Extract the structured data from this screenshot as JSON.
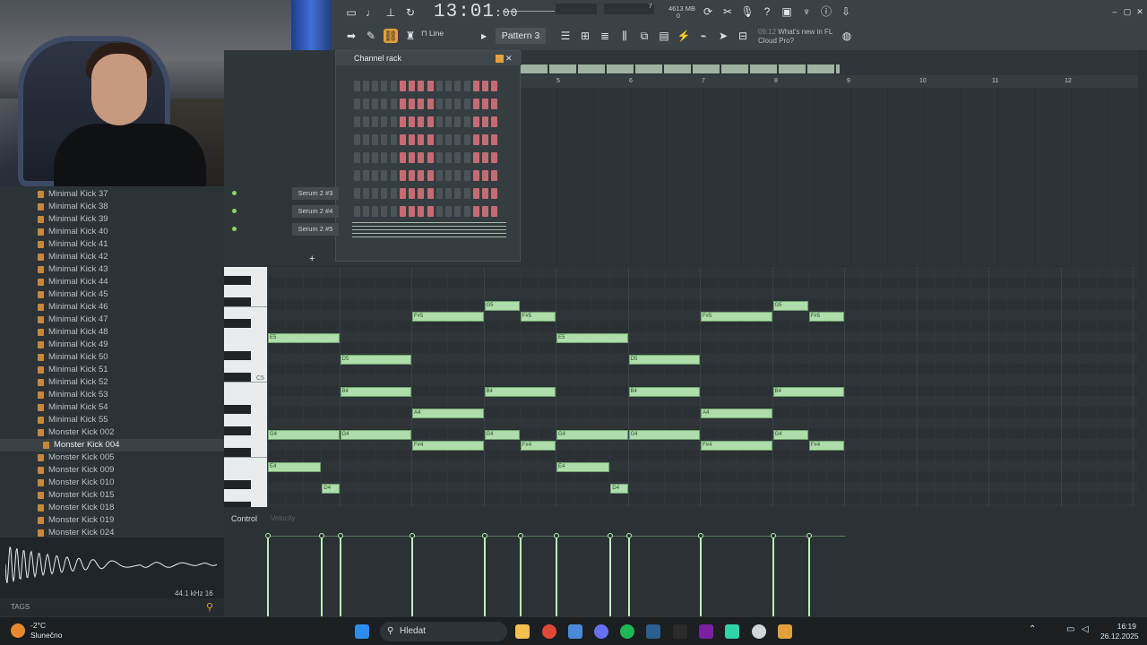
{
  "toolbar": {
    "time_main": "13:01",
    "time_sub": ":00",
    "bst": "B:S:T",
    "memory": "4613 MB",
    "cpu_a": "7",
    "cpu_b": "0",
    "polyphony": "0",
    "snap_mode": "Line",
    "pattern": "Pattern 3",
    "news_time": "09:12",
    "news_text_1": "What's new in FL",
    "news_text_2": "Cloud Pro?"
  },
  "channel_rack": {
    "title": "Channel rack",
    "channels": [
      {
        "name": "Serum 2 #3"
      },
      {
        "name": "Serum 2 #4"
      },
      {
        "name": "Serum 2 #5"
      }
    ],
    "add_label": "+"
  },
  "browser": {
    "items": [
      "Minimal Kick 37",
      "Minimal Kick 38",
      "Minimal Kick 39",
      "Minimal Kick 40",
      "Minimal Kick 41",
      "Minimal Kick 42",
      "Minimal Kick 43",
      "Minimal Kick 44",
      "Minimal Kick 45",
      "Minimal Kick 46",
      "Minimal Kick 47",
      "Minimal Kick 48",
      "Minimal Kick 49",
      "Minimal Kick 50",
      "Minimal Kick 51",
      "Minimal Kick 52",
      "Minimal Kick 53",
      "Minimal Kick 54",
      "Minimal Kick 55",
      "Monster Kick 002",
      "Monster Kick 004",
      "Monster Kick 005",
      "Monster Kick 009",
      "Monster Kick 010",
      "Monster Kick 015",
      "Monster Kick 018",
      "Monster Kick 019",
      "Monster Kick 024"
    ],
    "selected_index": 20,
    "sample_rate": "44.1 kHz 16",
    "tags_label": "TAGS"
  },
  "playlist": {
    "ruler": [
      "5",
      "6",
      "7",
      "8",
      "9",
      "10",
      "11",
      "12"
    ]
  },
  "piano_roll": {
    "c5_label": "C5",
    "notes": [
      {
        "pitch": "E5",
        "start": 0,
        "len": 4
      },
      {
        "pitch": "D5",
        "start": 4,
        "len": 4
      },
      {
        "pitch": "B4",
        "start": 4,
        "len": 4
      },
      {
        "pitch": "G4",
        "start": 0,
        "len": 4
      },
      {
        "pitch": "G4",
        "start": 4,
        "len": 4
      },
      {
        "pitch": "E4",
        "start": 0,
        "len": 3
      },
      {
        "pitch": "D4",
        "start": 3,
        "len": 1
      },
      {
        "pitch": "F#5",
        "start": 8,
        "len": 4
      },
      {
        "pitch": "A4",
        "start": 8,
        "len": 4
      },
      {
        "pitch": "F#4",
        "start": 8,
        "len": 4
      },
      {
        "pitch": "G5",
        "start": 12,
        "len": 2
      },
      {
        "pitch": "F#5",
        "start": 14,
        "len": 2
      },
      {
        "pitch": "B4",
        "start": 12,
        "len": 4
      },
      {
        "pitch": "G4",
        "start": 12,
        "len": 2
      },
      {
        "pitch": "F#4",
        "start": 14,
        "len": 2
      },
      {
        "pitch": "E5",
        "start": 16,
        "len": 4
      },
      {
        "pitch": "G4",
        "start": 16,
        "len": 4
      },
      {
        "pitch": "E4",
        "start": 16,
        "len": 3
      },
      {
        "pitch": "D4",
        "start": 19,
        "len": 1
      },
      {
        "pitch": "D5",
        "start": 20,
        "len": 4
      },
      {
        "pitch": "B4",
        "start": 20,
        "len": 4
      },
      {
        "pitch": "G4",
        "start": 20,
        "len": 4
      },
      {
        "pitch": "F#5",
        "start": 24,
        "len": 4
      },
      {
        "pitch": "A4",
        "start": 24,
        "len": 4
      },
      {
        "pitch": "F#4",
        "start": 24,
        "len": 4
      },
      {
        "pitch": "G5",
        "start": 28,
        "len": 2
      },
      {
        "pitch": "F#5",
        "start": 30,
        "len": 2
      },
      {
        "pitch": "B4",
        "start": 28,
        "len": 4
      },
      {
        "pitch": "G4",
        "start": 28,
        "len": 2
      },
      {
        "pitch": "F#4",
        "start": 30,
        "len": 2
      }
    ]
  },
  "control": {
    "label": "Control",
    "sub": "Velocity"
  },
  "taskbar": {
    "temperature": "-2°C",
    "weather": "Slunečno",
    "search": "Hledat",
    "time": "16:19",
    "date": "26.12.2025"
  },
  "colors": {
    "note": "#aedcab",
    "step_on": "#c56b72",
    "accent": "#8fd16a"
  }
}
